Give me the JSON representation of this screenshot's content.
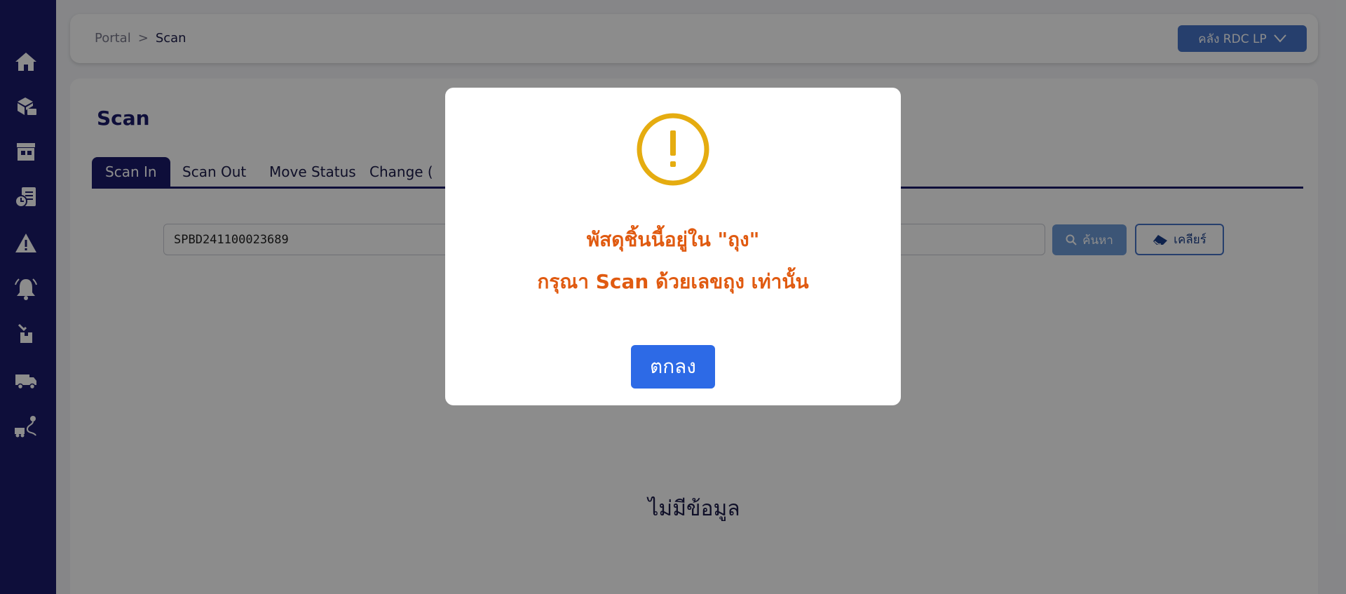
{
  "sidebar": {
    "items": [
      {
        "icon": "home-icon"
      },
      {
        "icon": "parcel-cart-icon"
      },
      {
        "icon": "store-icon"
      },
      {
        "icon": "report-clock-icon"
      },
      {
        "icon": "warning-icon"
      },
      {
        "icon": "bell-icon"
      },
      {
        "icon": "hand-box-icon"
      },
      {
        "icon": "truck-icon"
      },
      {
        "icon": "route-truck-icon"
      }
    ]
  },
  "header": {
    "breadcrumb": {
      "root": "Portal",
      "separator": ">",
      "current": "Scan"
    },
    "warehouse_label": "คลัง RDC LP"
  },
  "page": {
    "title": "Scan",
    "tabs": [
      {
        "label": "Scan In",
        "active": true
      },
      {
        "label": "Scan Out",
        "active": false
      },
      {
        "label": "Move Status",
        "active": false
      },
      {
        "label": "Change (",
        "active": false
      }
    ],
    "scan_input_value": "SPBD241100023689",
    "search_label": "ค้นหา",
    "clear_label": "เคลียร์",
    "empty_text": "ไม่มีข้อมูล"
  },
  "modal": {
    "icon": "exclamation-circle-icon",
    "line1": "พัสดุชิ้นนี้อยู่ใน \"ถุง\"",
    "line2": "กรุณา Scan ด้วยเลขถุง เท่านั้น",
    "ok_label": "ตกลง"
  },
  "colors": {
    "sidebar": "#1b1b6b",
    "accent": "#4674c6",
    "warning": "#e5ac10",
    "message": "#e05a10",
    "ok_button": "#2d6ae6"
  }
}
